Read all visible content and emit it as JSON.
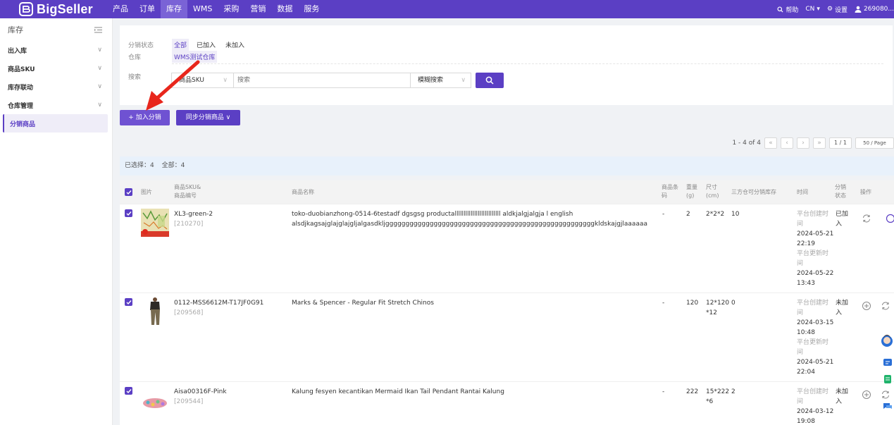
{
  "app": {
    "logo": "BigSeller"
  },
  "nav": [
    {
      "label": "产品",
      "active": false
    },
    {
      "label": "订单",
      "active": false
    },
    {
      "label": "库存",
      "active": true
    },
    {
      "label": "WMS",
      "active": false
    },
    {
      "label": "采购",
      "active": false
    },
    {
      "label": "营销",
      "active": false
    },
    {
      "label": "数据",
      "active": false
    },
    {
      "label": "服务",
      "active": false
    }
  ],
  "top_right": {
    "help": "帮助",
    "lang": "CN",
    "settings": "设置",
    "user": "269080..."
  },
  "sidebar": {
    "title": "库存",
    "items": [
      {
        "label": "出入库",
        "has_chevron": true
      },
      {
        "label": "商品SKU",
        "has_chevron": true
      },
      {
        "label": "库存联动",
        "has_chevron": true
      },
      {
        "label": "仓库管理",
        "has_chevron": true
      },
      {
        "label": "分销商品",
        "has_chevron": false,
        "active": true
      }
    ]
  },
  "filter": {
    "status_label": "分销状态",
    "status_options": [
      "全部",
      "已加入",
      "未加入"
    ],
    "status_selected": "全部",
    "warehouse_label": "仓库",
    "warehouse_value": "WMS测试仓库",
    "search_label": "搜索",
    "search_field": "商品SKU",
    "search_placeholder": "搜索",
    "search_mode": "模糊搜索"
  },
  "actions": {
    "add": "+ 加入分销",
    "sync": "同步分销商品 ∨"
  },
  "pager": {
    "range": "1 - 4 of 4",
    "page": "1 / 1",
    "size": "50 / Page"
  },
  "selection": {
    "selected": "已选择：4",
    "total": "全部：4"
  },
  "table": {
    "headers": {
      "image": "图片",
      "sku": [
        "商品SKU&",
        "商品编号"
      ],
      "name": "商品名称",
      "barcode": [
        "商品条",
        "码"
      ],
      "weight": [
        "重量",
        "(g)"
      ],
      "size": [
        "尺寸",
        "(cm)"
      ],
      "stock": "三方仓可分销库存",
      "time": "时间",
      "status": [
        "分销",
        "状态"
      ],
      "ops": "操作"
    },
    "rows": [
      {
        "sku": "XL3-green-2",
        "code": "[210270]",
        "name_lines": [
          "toko-duobianzhong-0514-6testadf dgsgsg productallllllllllllllllllllllllll aldkjalgjalgja l english",
          "alsdjkagsajglajglajgljalgasdkljggggggggggggggggggggggggggggggggggggggggggggggggggggkldskajgjlaaaaaa"
        ],
        "barcode": "-",
        "weight": "2",
        "size_lines": [
          "2*2*2"
        ],
        "stock": "10",
        "time_lines": [
          "平台创建时",
          "间",
          "2024-05-21",
          "22:19",
          "平台更新时",
          "间",
          "2024-05-22",
          "13:43"
        ],
        "status_lines": [
          "已加",
          "入"
        ]
      },
      {
        "sku": "0112-MSS6612M-T17JF0G91",
        "code": "[209568]",
        "name_lines": [
          "Marks & Spencer - Regular Fit Stretch Chinos"
        ],
        "barcode": "-",
        "weight": "120",
        "size_lines": [
          "12*120",
          "*12"
        ],
        "stock": "0",
        "time_lines": [
          "平台创建时",
          "间",
          "2024-03-15",
          "10:48",
          "平台更新时",
          "间",
          "2024-05-21",
          "22:04"
        ],
        "status_lines": [
          "未加",
          "入"
        ]
      },
      {
        "sku": "Aisa00316F-Pink",
        "code": "[209544]",
        "name_lines": [
          "Kalung fesyen kecantikan Mermaid Ikan Tail Pendant Rantai Kalung"
        ],
        "barcode": "-",
        "weight": "222",
        "size_lines": [
          "15*222",
          "*6"
        ],
        "stock": "2",
        "time_lines": [
          "平台创建时",
          "间",
          "2024-03-12",
          "19:08"
        ],
        "status_lines": [
          "未加",
          "入"
        ]
      }
    ]
  },
  "colors": {
    "brand": "#5b3fc4",
    "brand_light": "#efedf8",
    "arrow": "#e8261c",
    "selbar": "#e8f1fb"
  }
}
